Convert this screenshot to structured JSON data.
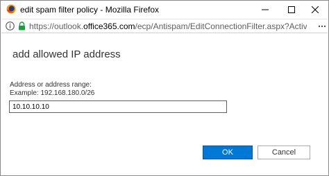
{
  "window": {
    "title": "edit spam filter policy - Mozilla Firefox",
    "controls": {
      "minimize": "minimize-icon",
      "maximize": "maximize-icon",
      "close": "close-icon"
    }
  },
  "urlbar": {
    "url_prefix": "https://outlook.",
    "url_domain": "office365.com",
    "url_suffix": "/ecp/Antispam/EditConnectionFilter.aspx?ActivityCorrelation",
    "icons": [
      "info-icon",
      "lock-icon",
      "page-menu-icon"
    ]
  },
  "dialog": {
    "heading": "add allowed IP address",
    "field_label": "Address or address range:",
    "field_example": "Example: 192.168.180.0/26",
    "input_value": "10.10.10.10",
    "ok_label": "OK",
    "cancel_label": "Cancel"
  },
  "colors": {
    "accent": "#0078d7",
    "text": "#333333",
    "border": "#8a8a8a"
  }
}
